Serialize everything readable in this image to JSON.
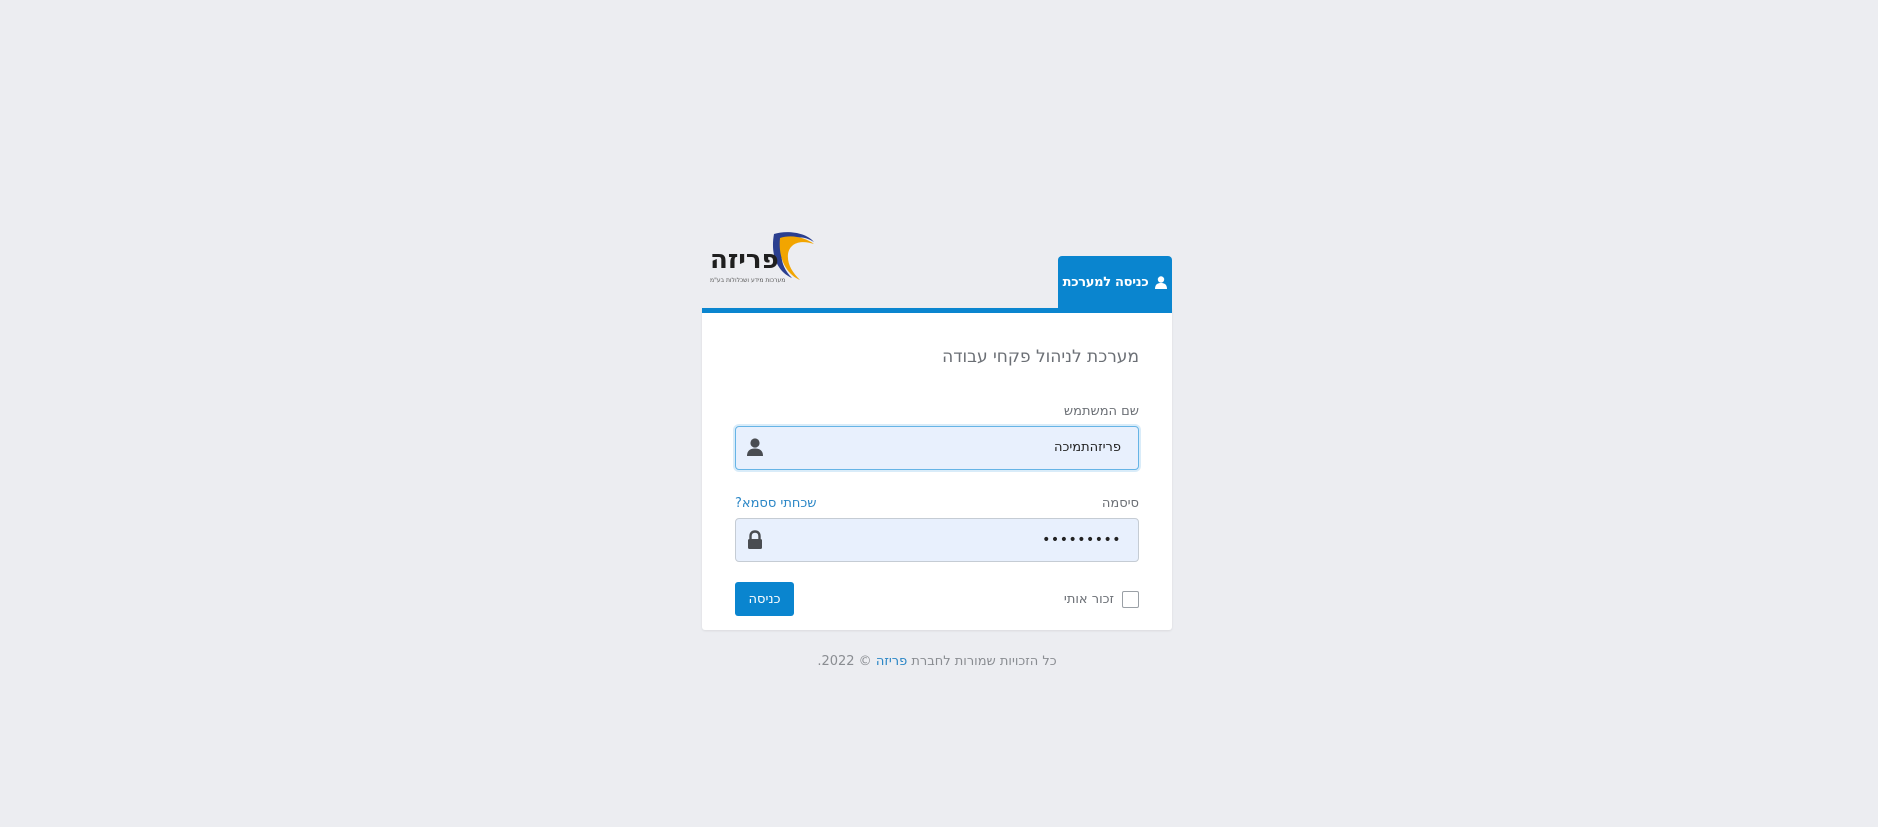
{
  "brand": {
    "logo_text": "פריזה",
    "logo_tagline": "מערכות מידע ושכלולות בע\"מ",
    "colors": {
      "primary": "#0a85cf",
      "logo_blue": "#2b3f8f",
      "logo_orange": "#f2a500"
    }
  },
  "tab": {
    "label": "כניסה למערכת",
    "icon": "user-icon"
  },
  "card": {
    "title": "מערכת לניהול פקחי עבודה"
  },
  "username": {
    "label": "שם המשתמש",
    "value": "פריזהתמיכה",
    "icon": "user-icon"
  },
  "password": {
    "label": "סיסמה",
    "value": "•••••••••",
    "forgot_link": "שכחתי ססמא?",
    "icon": "lock-icon"
  },
  "remember": {
    "label": "זכור אותי",
    "checked": false
  },
  "login_button": {
    "label": "כניסה"
  },
  "footer": {
    "prefix": "כל הזכויות שמורות לחברת",
    "company": "פריזה",
    "suffix": "© 2022."
  }
}
